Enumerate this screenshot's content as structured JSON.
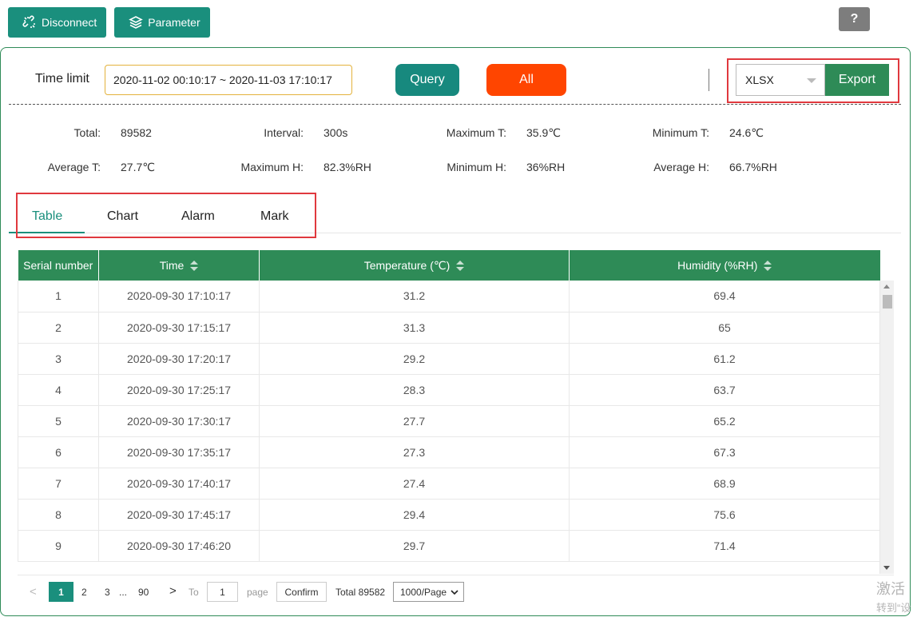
{
  "toolbar": {
    "disconnect_label": "Disconnect",
    "parameter_label": "Parameter",
    "help_label": "?"
  },
  "filter": {
    "time_limit_label": "Time limit",
    "time_range_value": "2020-11-02 00:10:17 ~ 2020-11-03 17:10:17",
    "query_label": "Query",
    "all_label": "All",
    "format_value": "XLSX",
    "export_label": "Export"
  },
  "stats": {
    "total_label": "Total:",
    "total_value": "89582",
    "interval_label": "Interval:",
    "interval_value": "300s",
    "max_t_label": "Maximum T:",
    "max_t_value": "35.9℃",
    "min_t_label": "Minimum T:",
    "min_t_value": "24.6℃",
    "avg_t_label": "Average T:",
    "avg_t_value": "27.7℃",
    "max_h_label": "Maximum H:",
    "max_h_value": "82.3%RH",
    "min_h_label": "Minimum H:",
    "min_h_value": "36%RH",
    "avg_h_label": "Average H:",
    "avg_h_value": "66.7%RH"
  },
  "tabs": [
    {
      "label": "Table"
    },
    {
      "label": "Chart"
    },
    {
      "label": "Alarm"
    },
    {
      "label": "Mark"
    }
  ],
  "table": {
    "headers": [
      "Serial number",
      "Time",
      "Temperature (℃)",
      "Humidity (%RH)"
    ],
    "rows": [
      [
        "1",
        "2020-09-30 17:10:17",
        "31.2",
        "69.4"
      ],
      [
        "2",
        "2020-09-30 17:15:17",
        "31.3",
        "65"
      ],
      [
        "3",
        "2020-09-30 17:20:17",
        "29.2",
        "61.2"
      ],
      [
        "4",
        "2020-09-30 17:25:17",
        "28.3",
        "63.7"
      ],
      [
        "5",
        "2020-09-30 17:30:17",
        "27.7",
        "65.2"
      ],
      [
        "6",
        "2020-09-30 17:35:17",
        "27.3",
        "67.3"
      ],
      [
        "7",
        "2020-09-30 17:40:17",
        "27.4",
        "68.9"
      ],
      [
        "8",
        "2020-09-30 17:45:17",
        "29.4",
        "75.6"
      ],
      [
        "9",
        "2020-09-30 17:46:20",
        "29.7",
        "71.4"
      ]
    ]
  },
  "pagination": {
    "prev": "<",
    "current": "1",
    "page2": "2",
    "page3": "3",
    "ellipsis": "...",
    "last": "90",
    "next": ">",
    "to_label": "To",
    "jump_value": "1",
    "page_label": "page",
    "confirm_label": "Confirm",
    "total_text": "Total 89582",
    "page_size": "1000/Page"
  },
  "watermark": {
    "line1": "激活",
    "line2": "转到“设"
  }
}
